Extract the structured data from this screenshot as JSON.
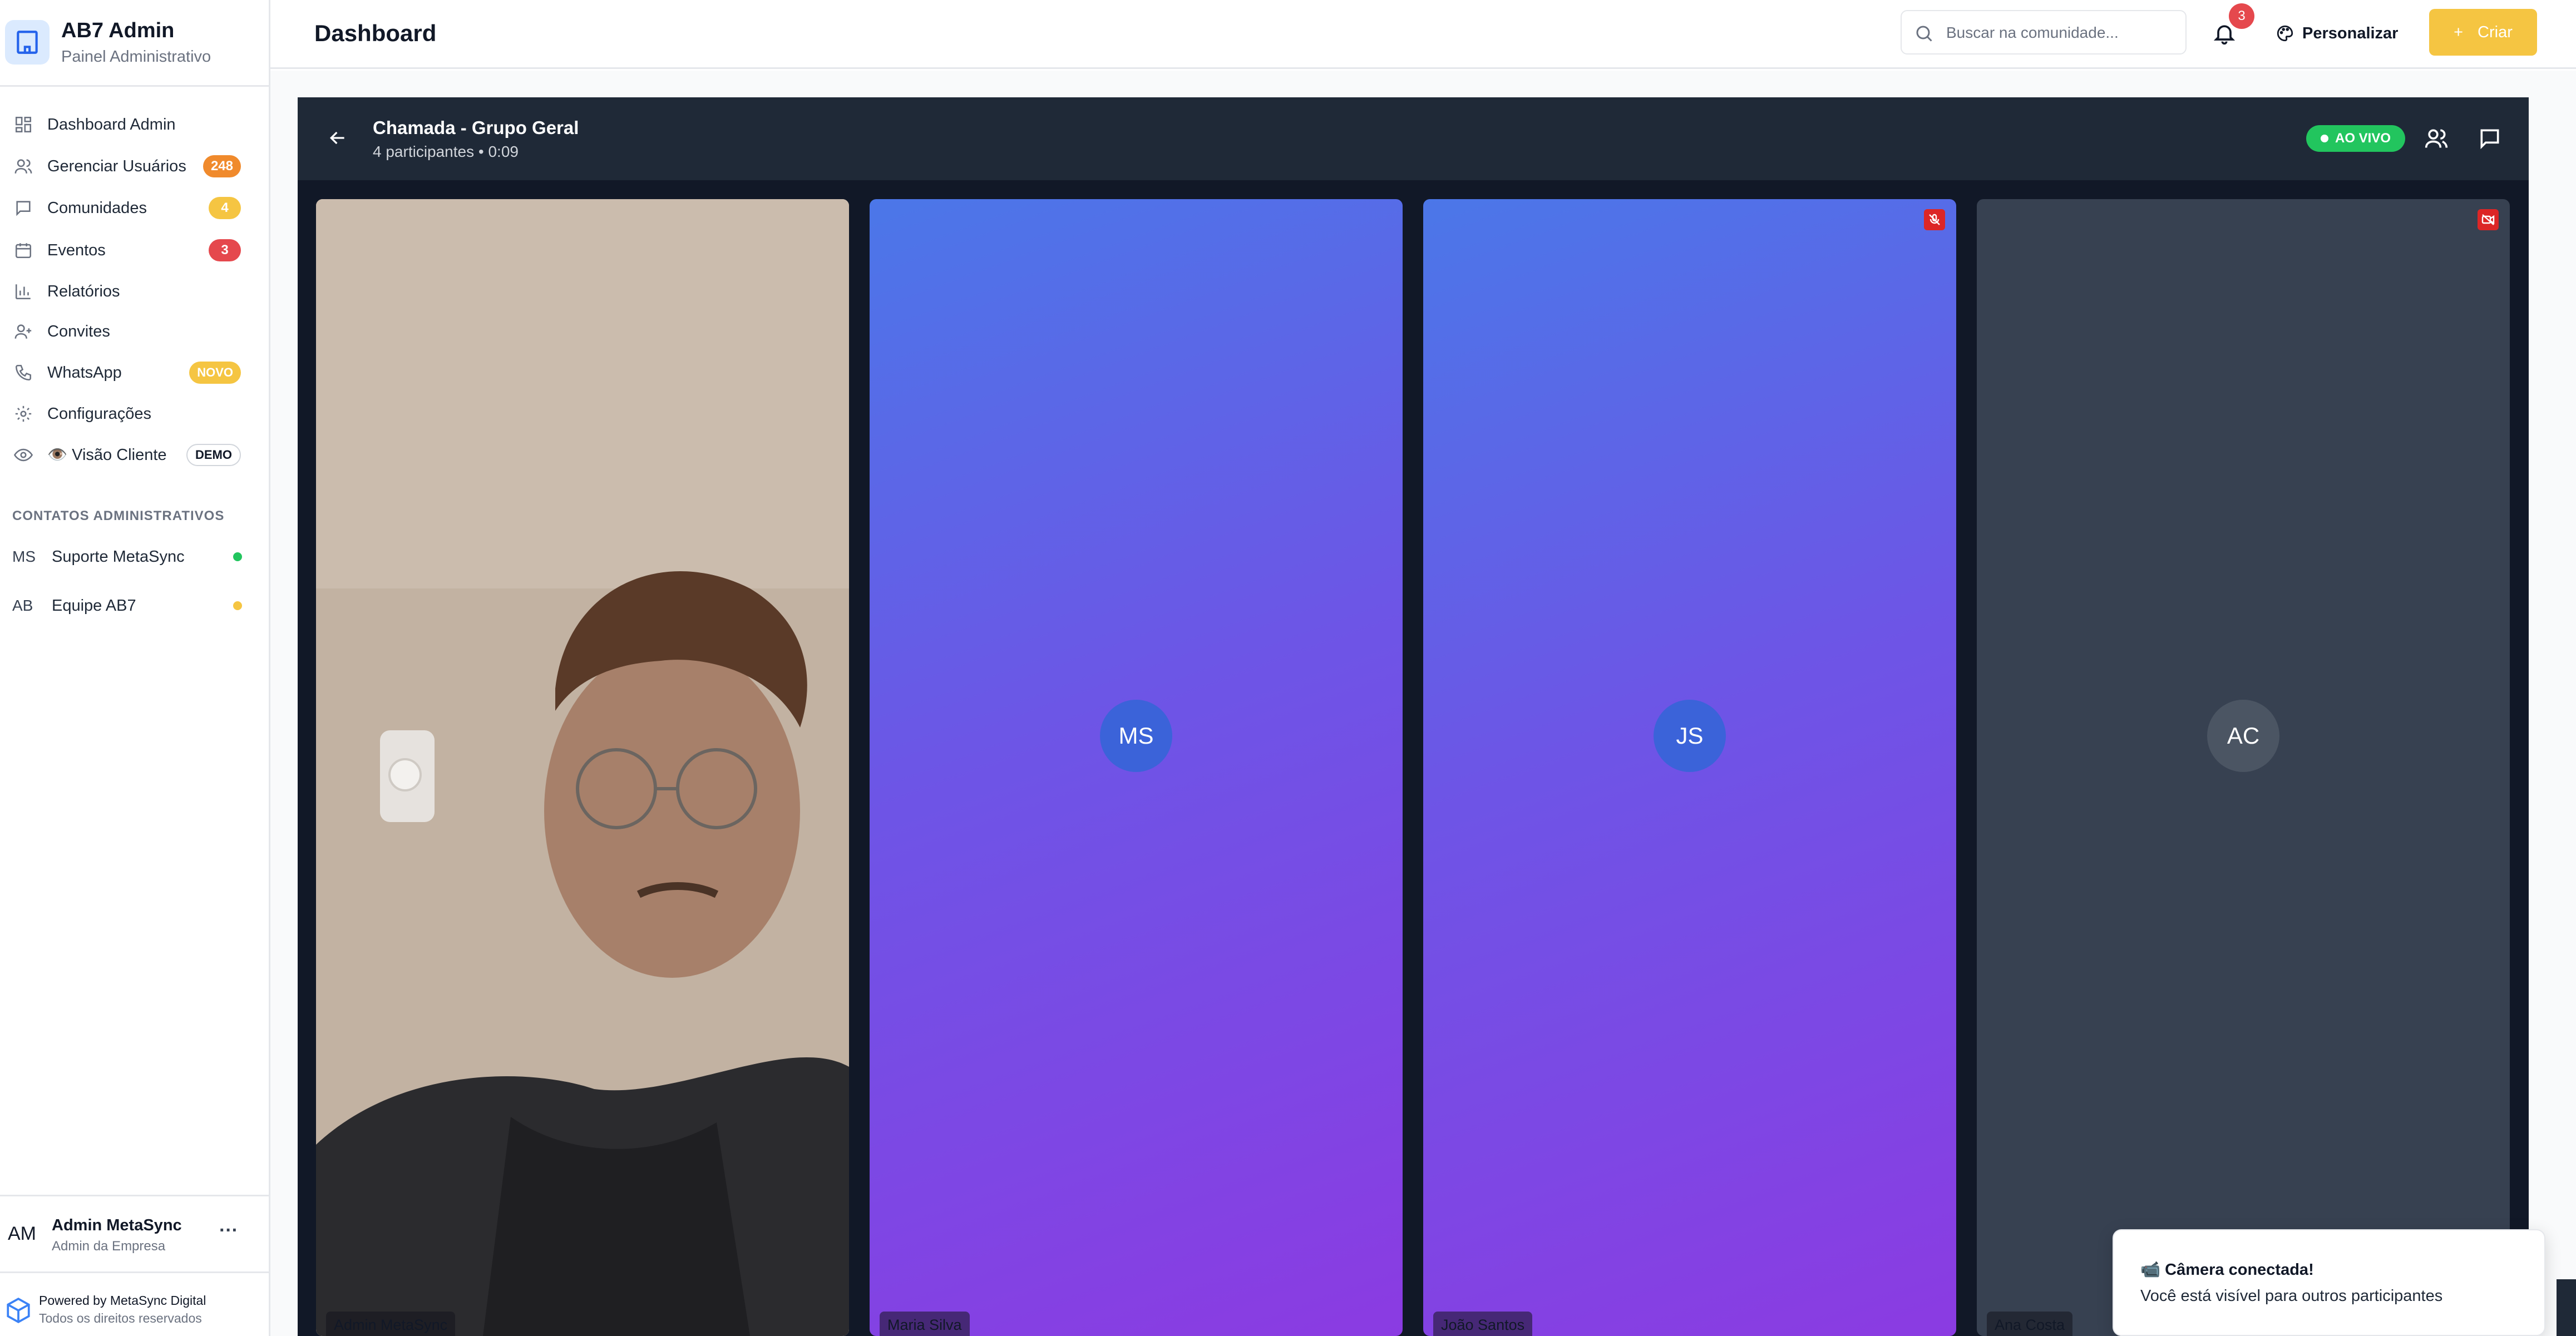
{
  "app": {
    "title": "AB7 Admin",
    "subtitle": "Painel Administrativo"
  },
  "sidebar": {
    "items": [
      {
        "label": "Dashboard Admin",
        "icon": "dashboard-icon"
      },
      {
        "label": "Gerenciar Usuários",
        "icon": "users-icon",
        "badge": "248"
      },
      {
        "label": "Comunidades",
        "icon": "chat-icon",
        "badge": "4"
      },
      {
        "label": "Eventos",
        "icon": "calendar-icon",
        "badge": "3"
      },
      {
        "label": "Relatórios",
        "icon": "bar-chart-icon"
      },
      {
        "label": "Convites",
        "icon": "user-plus-icon"
      },
      {
        "label": "WhatsApp",
        "icon": "phone-icon",
        "badge": "NOVO"
      },
      {
        "label": "Configurações",
        "icon": "gear-icon"
      },
      {
        "label": "👁️ Visão Cliente",
        "icon": "eye-icon",
        "badge": "DEMO"
      }
    ],
    "contacts_title": "CONTATOS ADMINISTRATIVOS",
    "contacts": [
      {
        "initials": "MS",
        "name": "Suporte MetaSync",
        "status_color": "#22c55e"
      },
      {
        "initials": "AB",
        "name": "Equipe AB7",
        "status_color": "#f5c542"
      }
    ],
    "user": {
      "initials": "AM",
      "name": "Admin MetaSync",
      "role": "Admin da Empresa",
      "more": "···"
    },
    "footer": {
      "line1": "Powered by MetaSync Digital",
      "line2": "Todos os direitos reservados"
    }
  },
  "header": {
    "title": "Dashboard",
    "search_placeholder": "Buscar na comunidade...",
    "notifications_count": "3",
    "customize_label": "Personalizar",
    "create_label": "Criar",
    "create_icon": "+"
  },
  "call": {
    "title": "Chamada - Grupo Geral",
    "subtitle": "4 participantes • 0:09",
    "live_label": "AO VIVO",
    "participants": [
      {
        "name": "Admin MetaSync",
        "initials": "",
        "video": true,
        "muted": false
      },
      {
        "name": "Maria Silva",
        "initials": "MS",
        "video": false,
        "muted": false
      },
      {
        "name": "João Santos",
        "initials": "JS",
        "video": false,
        "muted": true
      },
      {
        "name": "Ana Costa",
        "initials": "AC",
        "video": false,
        "muted": false,
        "camera_off": true
      }
    ]
  },
  "toast": {
    "title": "📹 Câmera conectada!",
    "message": "Você está visível para outros participantes"
  },
  "colors": {
    "accent": "#f5c542",
    "badge_orange": "#f08a2c",
    "badge_red": "#e5484d",
    "live_green": "#22c55e",
    "call_bg": "#111827",
    "tile_gradient_start": "#4b77e8",
    "tile_gradient_end": "#8b3be2"
  }
}
